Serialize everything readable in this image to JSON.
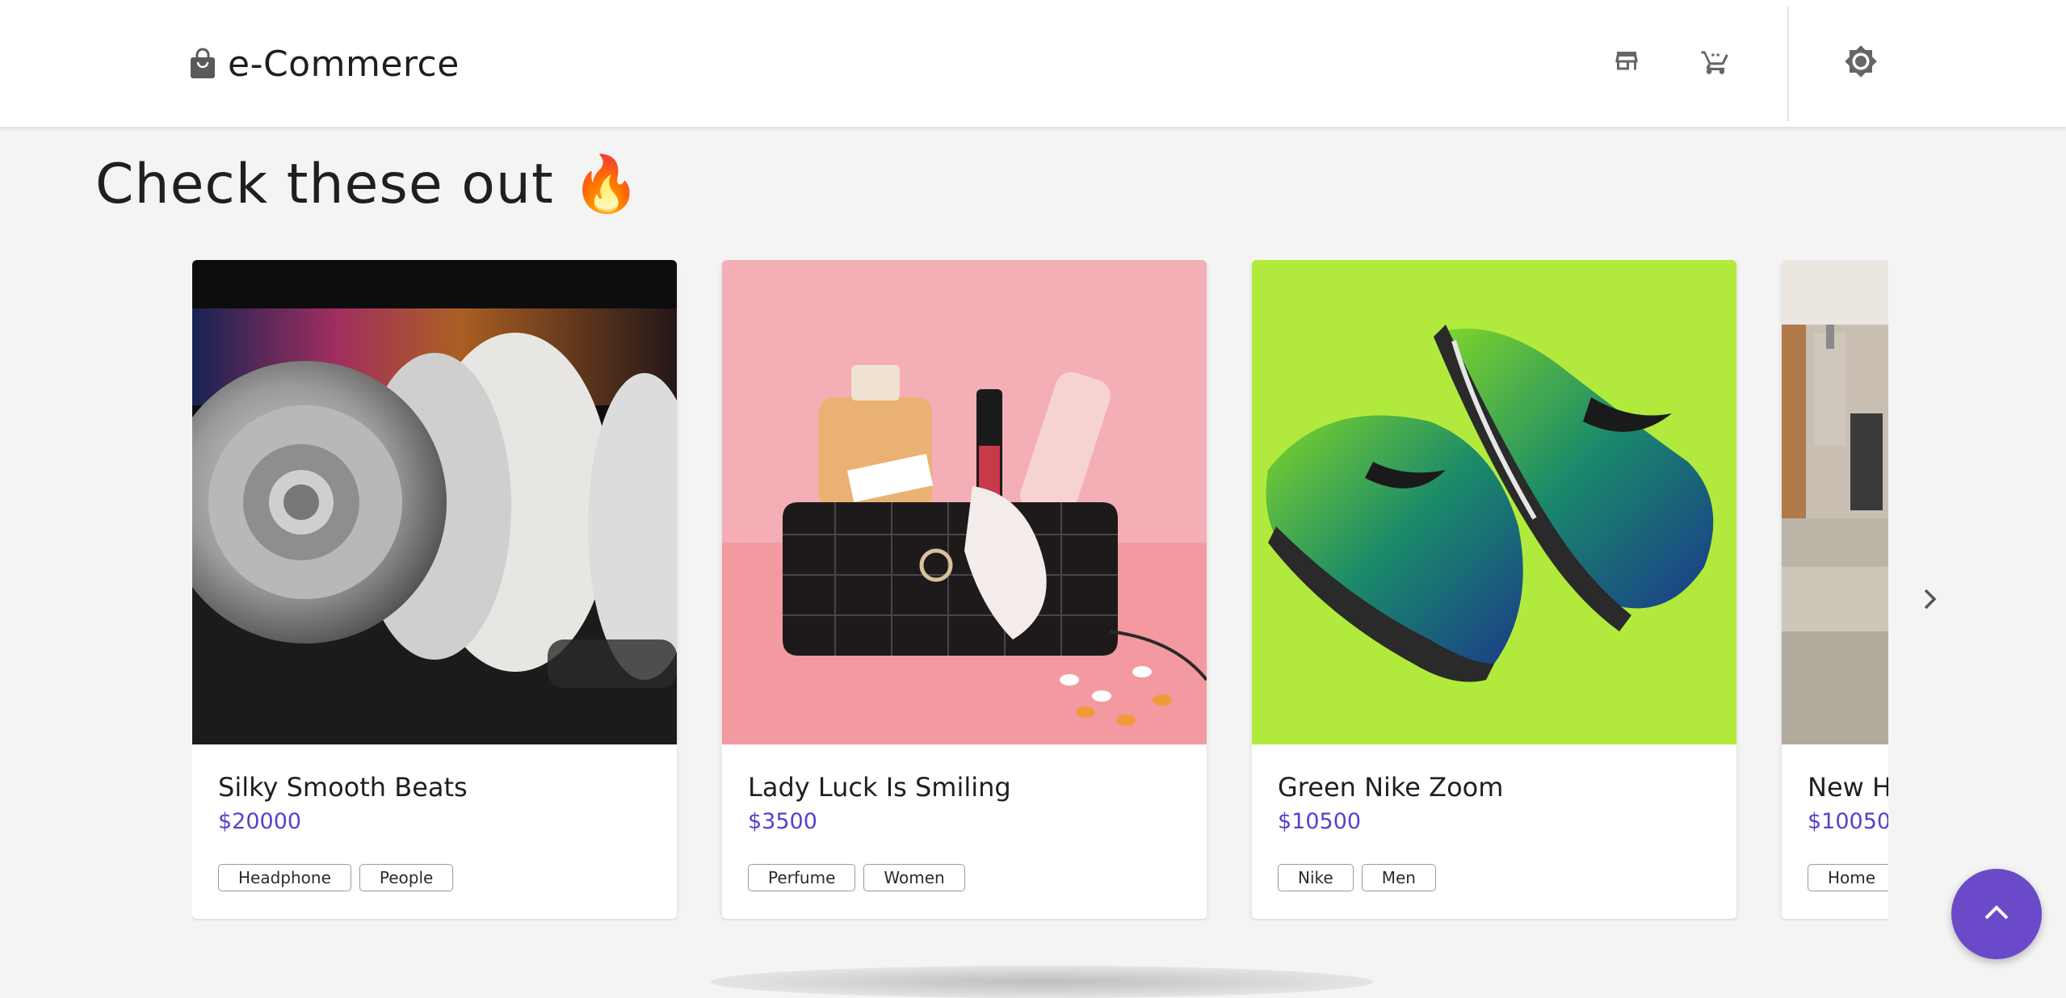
{
  "header": {
    "brand_name": "e-Commerce",
    "icons": [
      "shopping-bag-icon",
      "store-icon",
      "cart-icon",
      "theme-toggle-icon"
    ]
  },
  "section": {
    "title": "Check these out",
    "emoji": "🔥"
  },
  "products": [
    {
      "title": "Silky Smooth Beats",
      "price": "$20000",
      "tags": [
        "Headphone",
        "People"
      ]
    },
    {
      "title": "Lady Luck Is Smiling",
      "price": "$3500",
      "tags": [
        "Perfume",
        "Women"
      ]
    },
    {
      "title": "Green Nike Zoom",
      "price": "$10500",
      "tags": [
        "Nike",
        "Men"
      ]
    },
    {
      "title": "New Ho",
      "price": "$10050",
      "tags": [
        "Home"
      ]
    }
  ],
  "colors": {
    "accent": "#6a4ac9",
    "price": "#5b3fc9"
  },
  "controls": {
    "next_icon": "chevron-right-icon",
    "scroll_top_icon": "chevron-up-icon"
  }
}
